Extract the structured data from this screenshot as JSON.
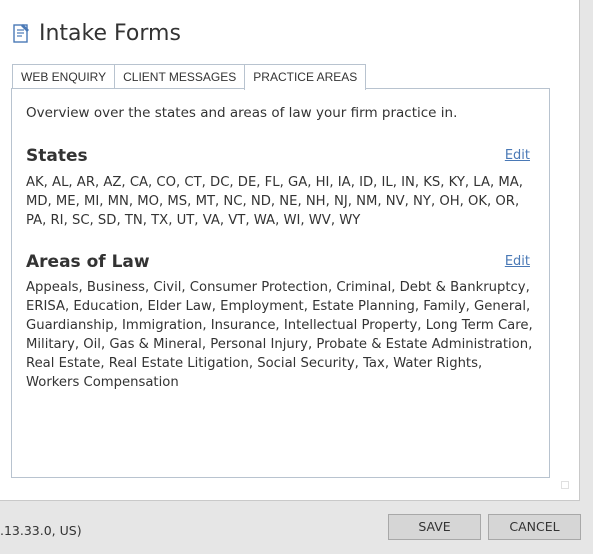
{
  "header": {
    "title": "Intake Forms",
    "icon": "form-edit-icon"
  },
  "tabs": [
    {
      "label": "WEB ENQUIRY",
      "active": false
    },
    {
      "label": "CLIENT MESSAGES",
      "active": false
    },
    {
      "label": "PRACTICE AREAS",
      "active": true
    }
  ],
  "main": {
    "overview": "Overview over the states and areas of law your firm practice in.",
    "states": {
      "title": "States",
      "edit_label": "Edit",
      "text": "AK, AL, AR, AZ, CA, CO, CT, DC, DE, FL, GA, HI, IA, ID, IL, IN, KS, KY, LA, MA, MD, ME, MI, MN, MO, MS, MT, NC, ND, NE, NH, NJ, NM, NV, NY, OH, OK, OR, PA, RI, SC, SD, TN, TX, UT, VA, VT, WA, WI, WV, WY"
    },
    "areas": {
      "title": "Areas of Law",
      "edit_label": "Edit",
      "text": "Appeals, Business, Civil, Consumer Protection, Criminal, Debt & Bankruptcy, ERISA, Education, Elder Law, Employment, Estate Planning, Family, General, Guardianship, Immigration, Insurance, Intellectual Property, Long Term Care, Military, Oil, Gas & Mineral, Personal Injury, Probate & Estate Administration, Real Estate, Real Estate Litigation, Social Security, Tax, Water Rights, Workers Compensation"
    }
  },
  "footer": {
    "status": ".13.33.0, US)",
    "save_label": "SAVE",
    "cancel_label": "CANCEL"
  },
  "colors": {
    "link": "#4a79b6",
    "border": "#b8c3cf",
    "button_bg": "#d6d6d6"
  }
}
